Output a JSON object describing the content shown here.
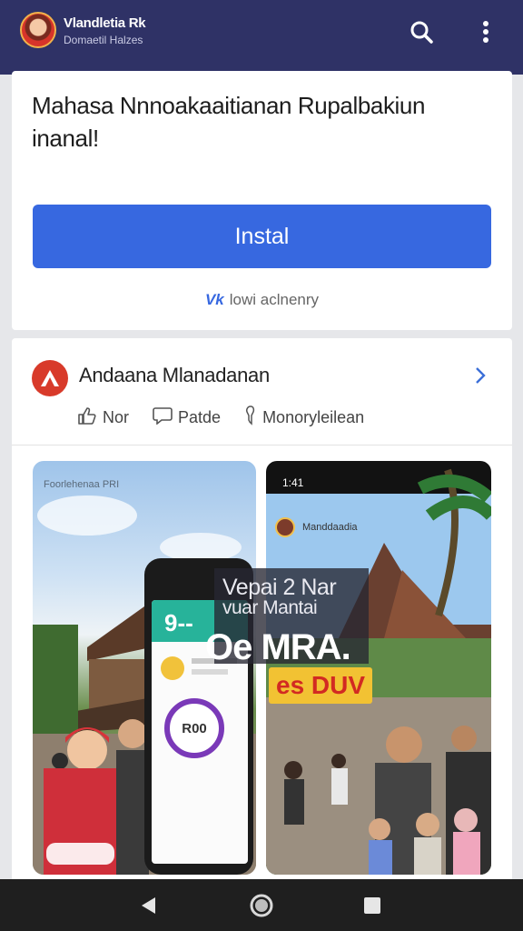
{
  "appbar": {
    "title": "Vlandletia Rk",
    "subtitle": "Domaetil Halzes",
    "icons": [
      "search-icon",
      "more-vert-icon"
    ]
  },
  "promo": {
    "text": "Mahasa Nnnoakaaitianan Rupalbakiun inanal!",
    "install_label": "Instal",
    "footnote_mark": "Vk",
    "footnote": "lowi aclnenry"
  },
  "post": {
    "brand": "Andaana Mlanadanan",
    "actions": [
      {
        "icon": "thumbs-up-icon",
        "label": "Nor"
      },
      {
        "icon": "comment-icon",
        "label": "Patde"
      },
      {
        "icon": "share-icon",
        "label": "Monoryleilean"
      }
    ],
    "left_image": {
      "caption": "Foorlehenaa PRI",
      "phone_text": "9--",
      "badge_text": "R00"
    },
    "right_image": {
      "status_time": "1:41",
      "header_name": "Manddaadia",
      "overlay_line1": "Vepai 2 Nar",
      "overlay_line1b": "vuar Mantai",
      "overlay_line2": "Oe MRA.",
      "overlay_tag": "es DUV"
    }
  },
  "colors": {
    "appbar": "#2f3266",
    "accent": "#3768e0",
    "brand": "#d83a2a",
    "tag_bg": "#f2c233"
  }
}
